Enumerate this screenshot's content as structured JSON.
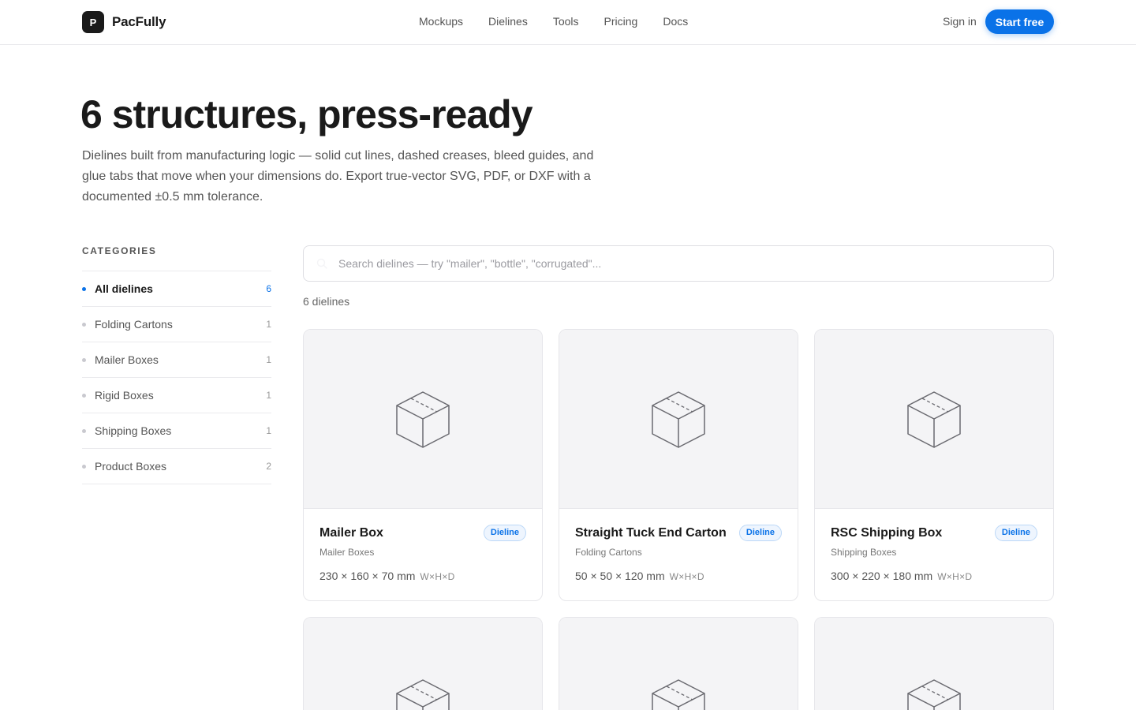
{
  "header": {
    "brand_mark": "P",
    "brand_name": "PacFully",
    "nav": [
      "Mockups",
      "Dielines",
      "Tools",
      "Pricing",
      "Docs"
    ],
    "sign_in": "Sign in",
    "cta": "Start free"
  },
  "hero": {
    "title": "6 structures, press-ready",
    "description": "Dielines built from manufacturing logic — solid cut lines, dashed creases, bleed guides, and glue tabs that move when your dimensions do. Export true-vector SVG, PDF, or DXF with a documented ±0.5 mm tolerance."
  },
  "sidebar": {
    "heading": "CATEGORIES",
    "items": [
      {
        "label": "All dielines",
        "count": "6",
        "active": true
      },
      {
        "label": "Folding Cartons",
        "count": "1"
      },
      {
        "label": "Mailer Boxes",
        "count": "1"
      },
      {
        "label": "Rigid Boxes",
        "count": "1"
      },
      {
        "label": "Shipping Boxes",
        "count": "1"
      },
      {
        "label": "Product Boxes",
        "count": "2"
      }
    ]
  },
  "search": {
    "placeholder": "Search dielines — try \"mailer\", \"bottle\", \"corrugated\"...",
    "value": ""
  },
  "results": {
    "count_text": "6 dielines"
  },
  "cards": [
    {
      "title": "Mailer Box",
      "badge": "Dieline",
      "category": "Mailer Boxes",
      "dims": "230 × 160 × 70 mm",
      "dims_unit": "W×H×D"
    },
    {
      "title": "Straight Tuck End Carton",
      "badge": "Dieline",
      "category": "Folding Cartons",
      "dims": "50 × 50 × 120 mm",
      "dims_unit": "W×H×D"
    },
    {
      "title": "RSC Shipping Box",
      "badge": "Dieline",
      "category": "Shipping Boxes",
      "dims": "300 × 220 × 180 mm",
      "dims_unit": "W×H×D"
    },
    {
      "title": "",
      "badge": "",
      "category": "",
      "dims": "",
      "dims_unit": ""
    },
    {
      "title": "",
      "badge": "",
      "category": "",
      "dims": "",
      "dims_unit": ""
    },
    {
      "title": "",
      "badge": "",
      "category": "",
      "dims": "",
      "dims_unit": ""
    }
  ],
  "colors": {
    "accent": "#0a72e8",
    "text": "#1a1a1a",
    "muted": "#555555",
    "thumb_bg": "#f4f4f6",
    "border": "#e6e6ea"
  },
  "icons": {
    "card_thumb": "box-icon",
    "search": "search-icon"
  }
}
